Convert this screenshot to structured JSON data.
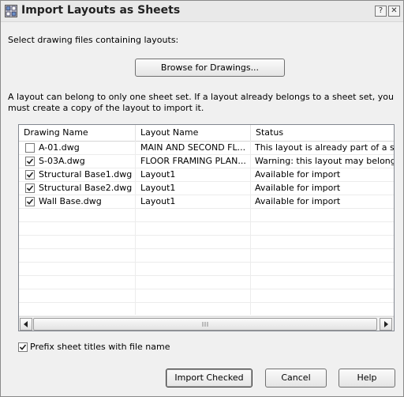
{
  "window": {
    "title": "Import Layouts as Sheets",
    "help_btn": "?",
    "close_btn": "✕"
  },
  "instructions": {
    "select_label": "Select drawing files containing layouts:",
    "note_line1": "A layout can belong to only one sheet set. If a layout already belongs to a sheet set, you",
    "note_line2": "must create a copy of the layout to import it."
  },
  "browse_button": "Browse for Drawings...",
  "table": {
    "columns": [
      "Drawing Name",
      "Layout Name",
      "Status"
    ],
    "rows": [
      {
        "checked": false,
        "drawing": "A-01.dwg",
        "layout": "MAIN AND SECOND FL...",
        "status": "This layout is already part of a sheet"
      },
      {
        "checked": true,
        "drawing": "S-03A.dwg",
        "layout": "FLOOR FRAMING PLAN...",
        "status": "Warning: this layout may belong to a"
      },
      {
        "checked": true,
        "drawing": "Structural Base1.dwg",
        "layout": "Layout1",
        "status": "Available for import"
      },
      {
        "checked": true,
        "drawing": "Structural Base2.dwg",
        "layout": "Layout1",
        "status": "Available for import"
      },
      {
        "checked": true,
        "drawing": "Wall Base.dwg",
        "layout": "Layout1",
        "status": "Available for import"
      }
    ]
  },
  "prefix_option": {
    "checked": true,
    "label": "Prefix sheet titles with file name"
  },
  "buttons": {
    "import_checked": "Import Checked",
    "cancel": "Cancel",
    "help": "Help"
  },
  "colors": {
    "window_bg": "#f0f0f0",
    "list_bg": "#ffffff",
    "border": "#828790"
  },
  "icons": {
    "app": "import-layouts-icon",
    "checkbox_on": "checkmark-icon",
    "scroll_left": "arrow-left-icon",
    "scroll_right": "arrow-right-icon"
  }
}
